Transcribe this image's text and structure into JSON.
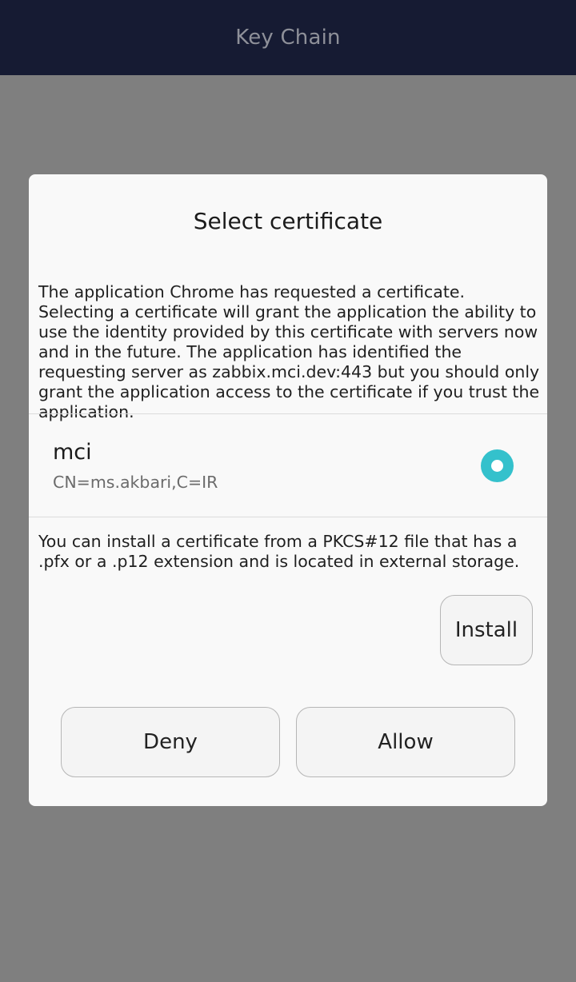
{
  "app_bar": {
    "title": "Key Chain"
  },
  "dialog": {
    "title": "Select certificate",
    "message": "The application Chrome has requested a certificate. Selecting a certificate will grant the application the ability to use the identity provided by this certificate with servers now and in the future. The application has identified the requesting server as zabbix.mci.dev:443 but you should only grant the application access to the certificate if you trust the application.",
    "certificates": [
      {
        "name": "mci",
        "subject": "CN=ms.akbari,C=IR",
        "selected": true
      }
    ],
    "install_info": "You can install a certificate from a PKCS#12 file that has a .pfx or a .p12 extension and is located in external storage.",
    "install_label": "Install",
    "deny_label": "Deny",
    "allow_label": "Allow"
  },
  "colors": {
    "app_bar_bg": "#161b33",
    "scrim": "#7f7f7f",
    "dialog_bg": "#f9f9f9",
    "radio_accent": "#34c1cc"
  },
  "icons": {
    "radio_selected": "radio-selected-icon"
  }
}
